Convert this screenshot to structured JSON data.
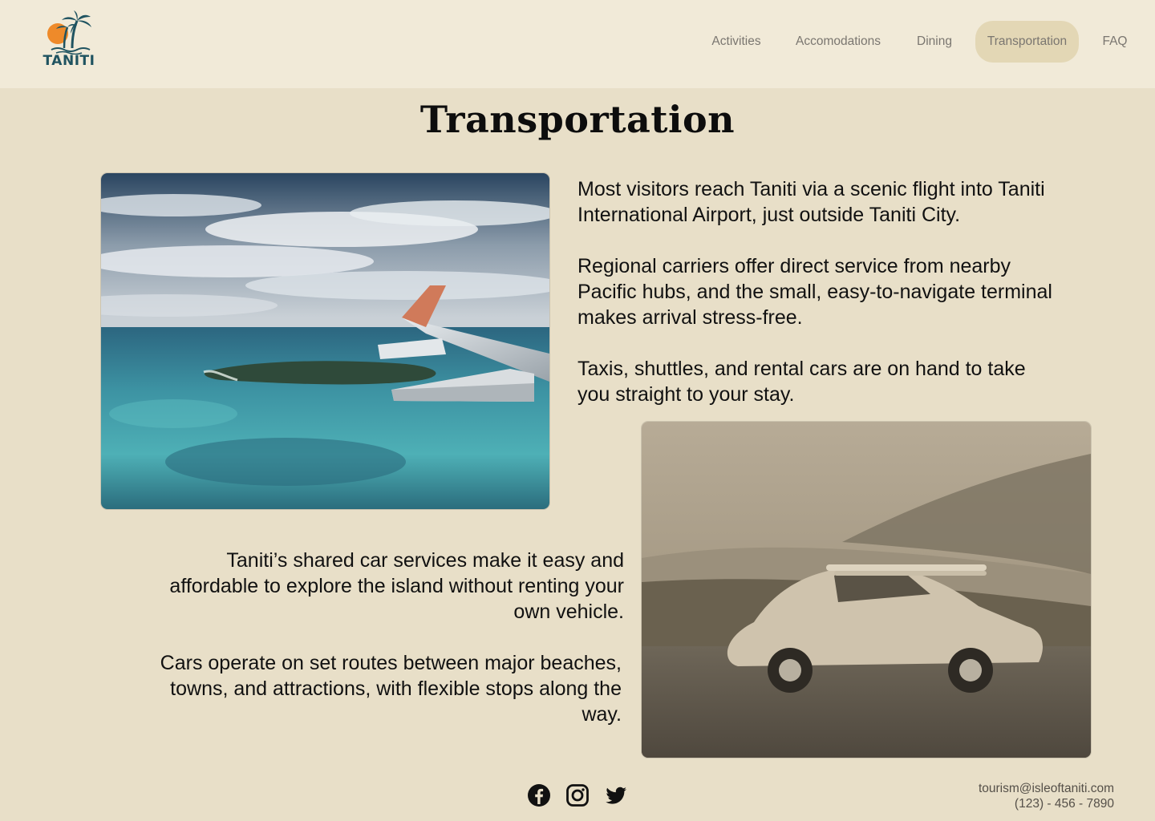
{
  "brand": {
    "name": "TANITI"
  },
  "nav": {
    "items": [
      {
        "label": "Activities",
        "active": false
      },
      {
        "label": "Accomodations",
        "active": false
      },
      {
        "label": "Dining",
        "active": false
      },
      {
        "label": "Transportation",
        "active": true
      },
      {
        "label": "FAQ",
        "active": false
      }
    ]
  },
  "page": {
    "title": "Transportation",
    "paragraphs": [
      "Most visitors reach Taniti via a scenic flight into Taniti International Airport, just outside Taniti City.",
      "Regional carriers offer direct service from nearby Pacific hubs, and the small, easy-to-navigate terminal makes arrival stress-free.",
      "Taxis, shuttles, and rental cars are on hand to take you straight to your stay.",
      "Taniti’s shared car services make it easy and affordable to explore the island without renting your own vehicle.",
      "Cars operate on set routes between major beaches, towns, and attractions, with flexible stops along the way."
    ]
  },
  "footer": {
    "social_icons": [
      "facebook-icon",
      "instagram-icon",
      "twitter-icon"
    ],
    "email": "tourism@isleoftaniti.com",
    "phone": "(123) - 456 - 7890"
  },
  "colors": {
    "page_background": "#e8dfc8",
    "header_background": "#f1ead8",
    "active_nav_background": "#e3d7b5",
    "logo_teal": "#1f5360",
    "logo_sun": "#ee8a2a"
  }
}
